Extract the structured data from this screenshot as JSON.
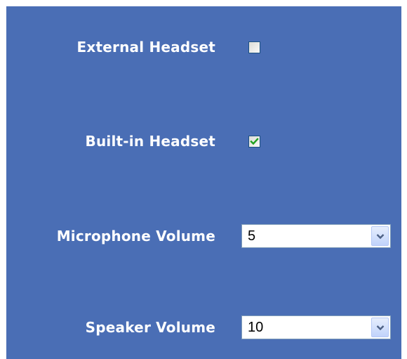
{
  "settings": {
    "external_headset": {
      "label": "External Headset",
      "checked": false
    },
    "builtin_headset": {
      "label": "Built-in Headset",
      "checked": true
    },
    "microphone_volume": {
      "label": "Microphone Volume",
      "value": "5"
    },
    "speaker_volume": {
      "label": "Speaker Volume",
      "value": "10"
    }
  },
  "colors": {
    "panel_background": "#4a6eb5",
    "label_text": "#ffffff",
    "check_mark": "#21a121",
    "dropdown_arrow": "#4d6185"
  },
  "icons": {
    "check": "check-icon",
    "dropdown": "chevron-down-icon"
  }
}
